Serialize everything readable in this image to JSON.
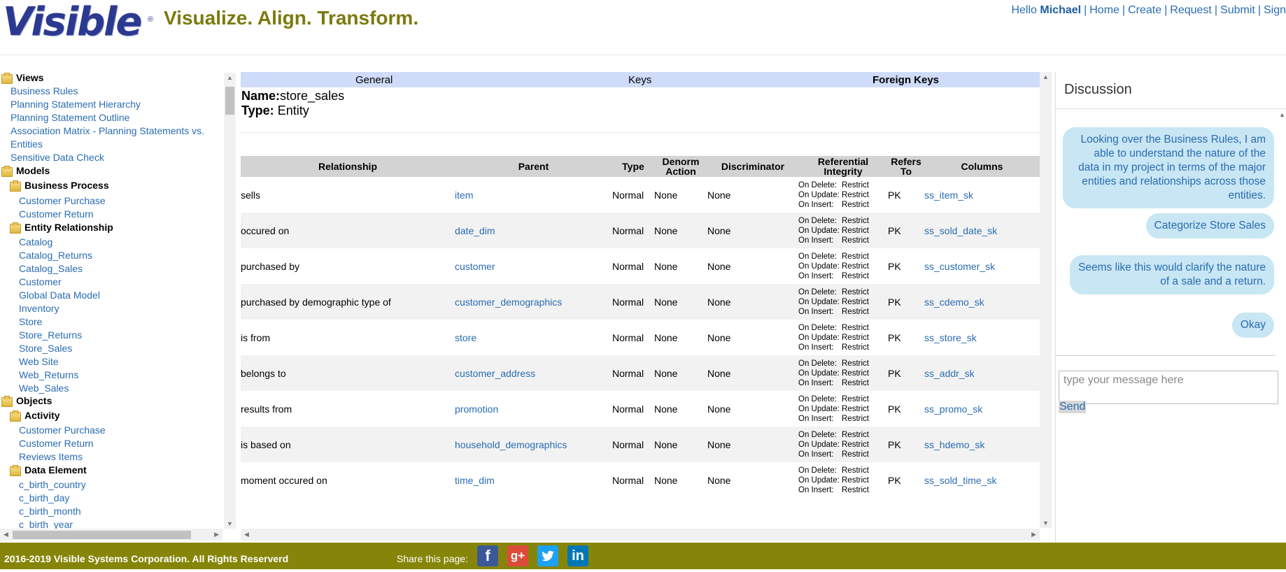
{
  "header": {
    "logo_text": "Visible",
    "logo_reg": "®",
    "tagline": "Visualize. Align. Transform.",
    "greeting": "Hello",
    "username": "Michael",
    "nav": [
      "Home",
      "Create",
      "Request",
      "Submit",
      "Sign"
    ]
  },
  "tree": {
    "views_label": "Views",
    "views": [
      "Business Rules",
      "Planning Statement Hierarchy",
      "Planning Statement Outline",
      "Association Matrix - Planning Statements vs.",
      "Entities",
      "Sensitive Data Check"
    ],
    "models_label": "Models",
    "business_process_label": "Business Process",
    "business_process": [
      "Customer Purchase",
      "Customer Return"
    ],
    "entity_relationship_label": "Entity Relationship",
    "entity_relationship": [
      "Catalog",
      "Catalog_Returns",
      "Catalog_Sales",
      "Customer",
      "Global Data Model",
      "Inventory",
      "Store",
      "Store_Returns",
      "Store_Sales",
      "Web Site",
      "Web_Returns",
      "Web_Sales"
    ],
    "objects_label": "Objects",
    "activity_label": "Activity",
    "activity": [
      "Customer Purchase",
      "Customer Return",
      "Reviews Items"
    ],
    "data_element_label": "Data Element",
    "data_element": [
      "c_birth_country",
      "c_birth_day",
      "c_birth_month",
      "c_birth_year"
    ]
  },
  "tabs": {
    "general": "General",
    "keys": "Keys",
    "foreign_keys": "Foreign Keys"
  },
  "entity": {
    "name_label": "Name:",
    "name": "store_sales",
    "type_label": "Type:",
    "type": "Entity"
  },
  "fk_table": {
    "headers": {
      "relationship": "Relationship",
      "parent": "Parent",
      "type": "Type",
      "denorm_1": "Denorm",
      "denorm_2": "Action",
      "discriminator": "Discriminator",
      "ri_1": "Referential",
      "ri_2": "Integrity",
      "refers_1": "Refers",
      "refers_2": "To",
      "columns": "Columns"
    },
    "ri_labels": {
      "on_delete": "On Delete:",
      "on_update": "On Update:",
      "on_insert": "On Insert:",
      "value": "Restrict"
    },
    "rows": [
      {
        "relationship": "sells",
        "parent": "item",
        "type": "Normal",
        "denorm": "None",
        "discriminator": "None",
        "refers_to": "PK",
        "columns": "ss_item_sk"
      },
      {
        "relationship": "occured on",
        "parent": "date_dim",
        "type": "Normal",
        "denorm": "None",
        "discriminator": "None",
        "refers_to": "PK",
        "columns": "ss_sold_date_sk"
      },
      {
        "relationship": "purchased by",
        "parent": "customer",
        "type": "Normal",
        "denorm": "None",
        "discriminator": "None",
        "refers_to": "PK",
        "columns": "ss_customer_sk"
      },
      {
        "relationship": "purchased by demographic type of",
        "parent": "customer_demographics",
        "type": "Normal",
        "denorm": "None",
        "discriminator": "None",
        "refers_to": "PK",
        "columns": "ss_cdemo_sk"
      },
      {
        "relationship": "is from",
        "parent": "store",
        "type": "Normal",
        "denorm": "None",
        "discriminator": "None",
        "refers_to": "PK",
        "columns": "ss_store_sk"
      },
      {
        "relationship": "belongs to",
        "parent": "customer_address",
        "type": "Normal",
        "denorm": "None",
        "discriminator": "None",
        "refers_to": "PK",
        "columns": "ss_addr_sk"
      },
      {
        "relationship": "results from",
        "parent": "promotion",
        "type": "Normal",
        "denorm": "None",
        "discriminator": "None",
        "refers_to": "PK",
        "columns": "ss_promo_sk"
      },
      {
        "relationship": "is based on",
        "parent": "household_demographics",
        "type": "Normal",
        "denorm": "None",
        "discriminator": "None",
        "refers_to": "PK",
        "columns": "ss_hdemo_sk"
      },
      {
        "relationship": "moment occured on",
        "parent": "time_dim",
        "type": "Normal",
        "denorm": "None",
        "discriminator": "None",
        "refers_to": "PK",
        "columns": "ss_sold_time_sk"
      }
    ]
  },
  "discussion": {
    "title": "Discussion",
    "messages": [
      "Looking over the Business Rules, I am able to understand the nature of the data in my project in terms of the major entities and relationships across those entities.",
      "Categorize Store Sales",
      "Seems like this would clarify the nature of a sale and a return.",
      "Okay"
    ],
    "input_placeholder": "type your message here",
    "send_label": "Send"
  },
  "footer": {
    "copyright": "2016-2019 Visible Systems Corporation. All Rights Reserverd",
    "share_label": "Share this page:",
    "social_icons": [
      "facebook-icon",
      "google-plus-icon",
      "twitter-icon",
      "linkedin-icon"
    ]
  },
  "colors": {
    "brand_blue": "#2b3990",
    "tagline_olive": "#7b7a0e",
    "link_blue": "#2a6cb0",
    "footer_olive": "#868509",
    "tab_bar": "#cfdcf9",
    "bubble": "#c8e6f4"
  }
}
